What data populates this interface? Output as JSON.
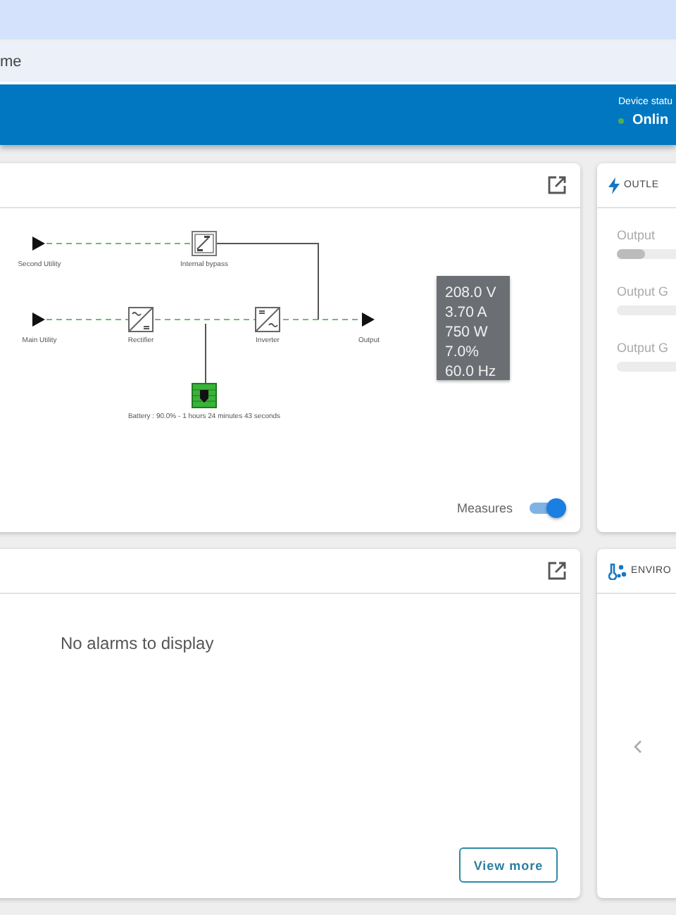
{
  "browser": {
    "address_text": "me"
  },
  "header": {
    "status_label": "Device statu",
    "status": "Onlin",
    "online": true
  },
  "synoptic": {
    "nodes": [
      {
        "kind": "source",
        "label": "Second Utility"
      },
      {
        "kind": "bypass",
        "label": "Internal bypass"
      },
      {
        "kind": "source",
        "label": "Main Utility"
      },
      {
        "kind": "rectifier",
        "label": "Rectifier"
      },
      {
        "kind": "inverter",
        "label": "Inverter"
      },
      {
        "kind": "output",
        "label": "Output"
      },
      {
        "kind": "battery",
        "label": "Battery : 90.0% - 1 hours 24 minutes 43 seconds"
      }
    ],
    "measures": [
      "208.0 V",
      "3.70 A",
      "750 W",
      "7.0%",
      "60.0 Hz"
    ],
    "measures_toggle": {
      "label": "Measures",
      "on": true
    }
  },
  "outlets": {
    "title": "OUTLE",
    "items": [
      {
        "label": "Output",
        "level": 0.1
      },
      {
        "label": "Output G"
      },
      {
        "label": "Output G"
      }
    ]
  },
  "alarms": {
    "message": "No alarms to display",
    "button": "View more"
  },
  "environment": {
    "title": "ENVIRO"
  }
}
